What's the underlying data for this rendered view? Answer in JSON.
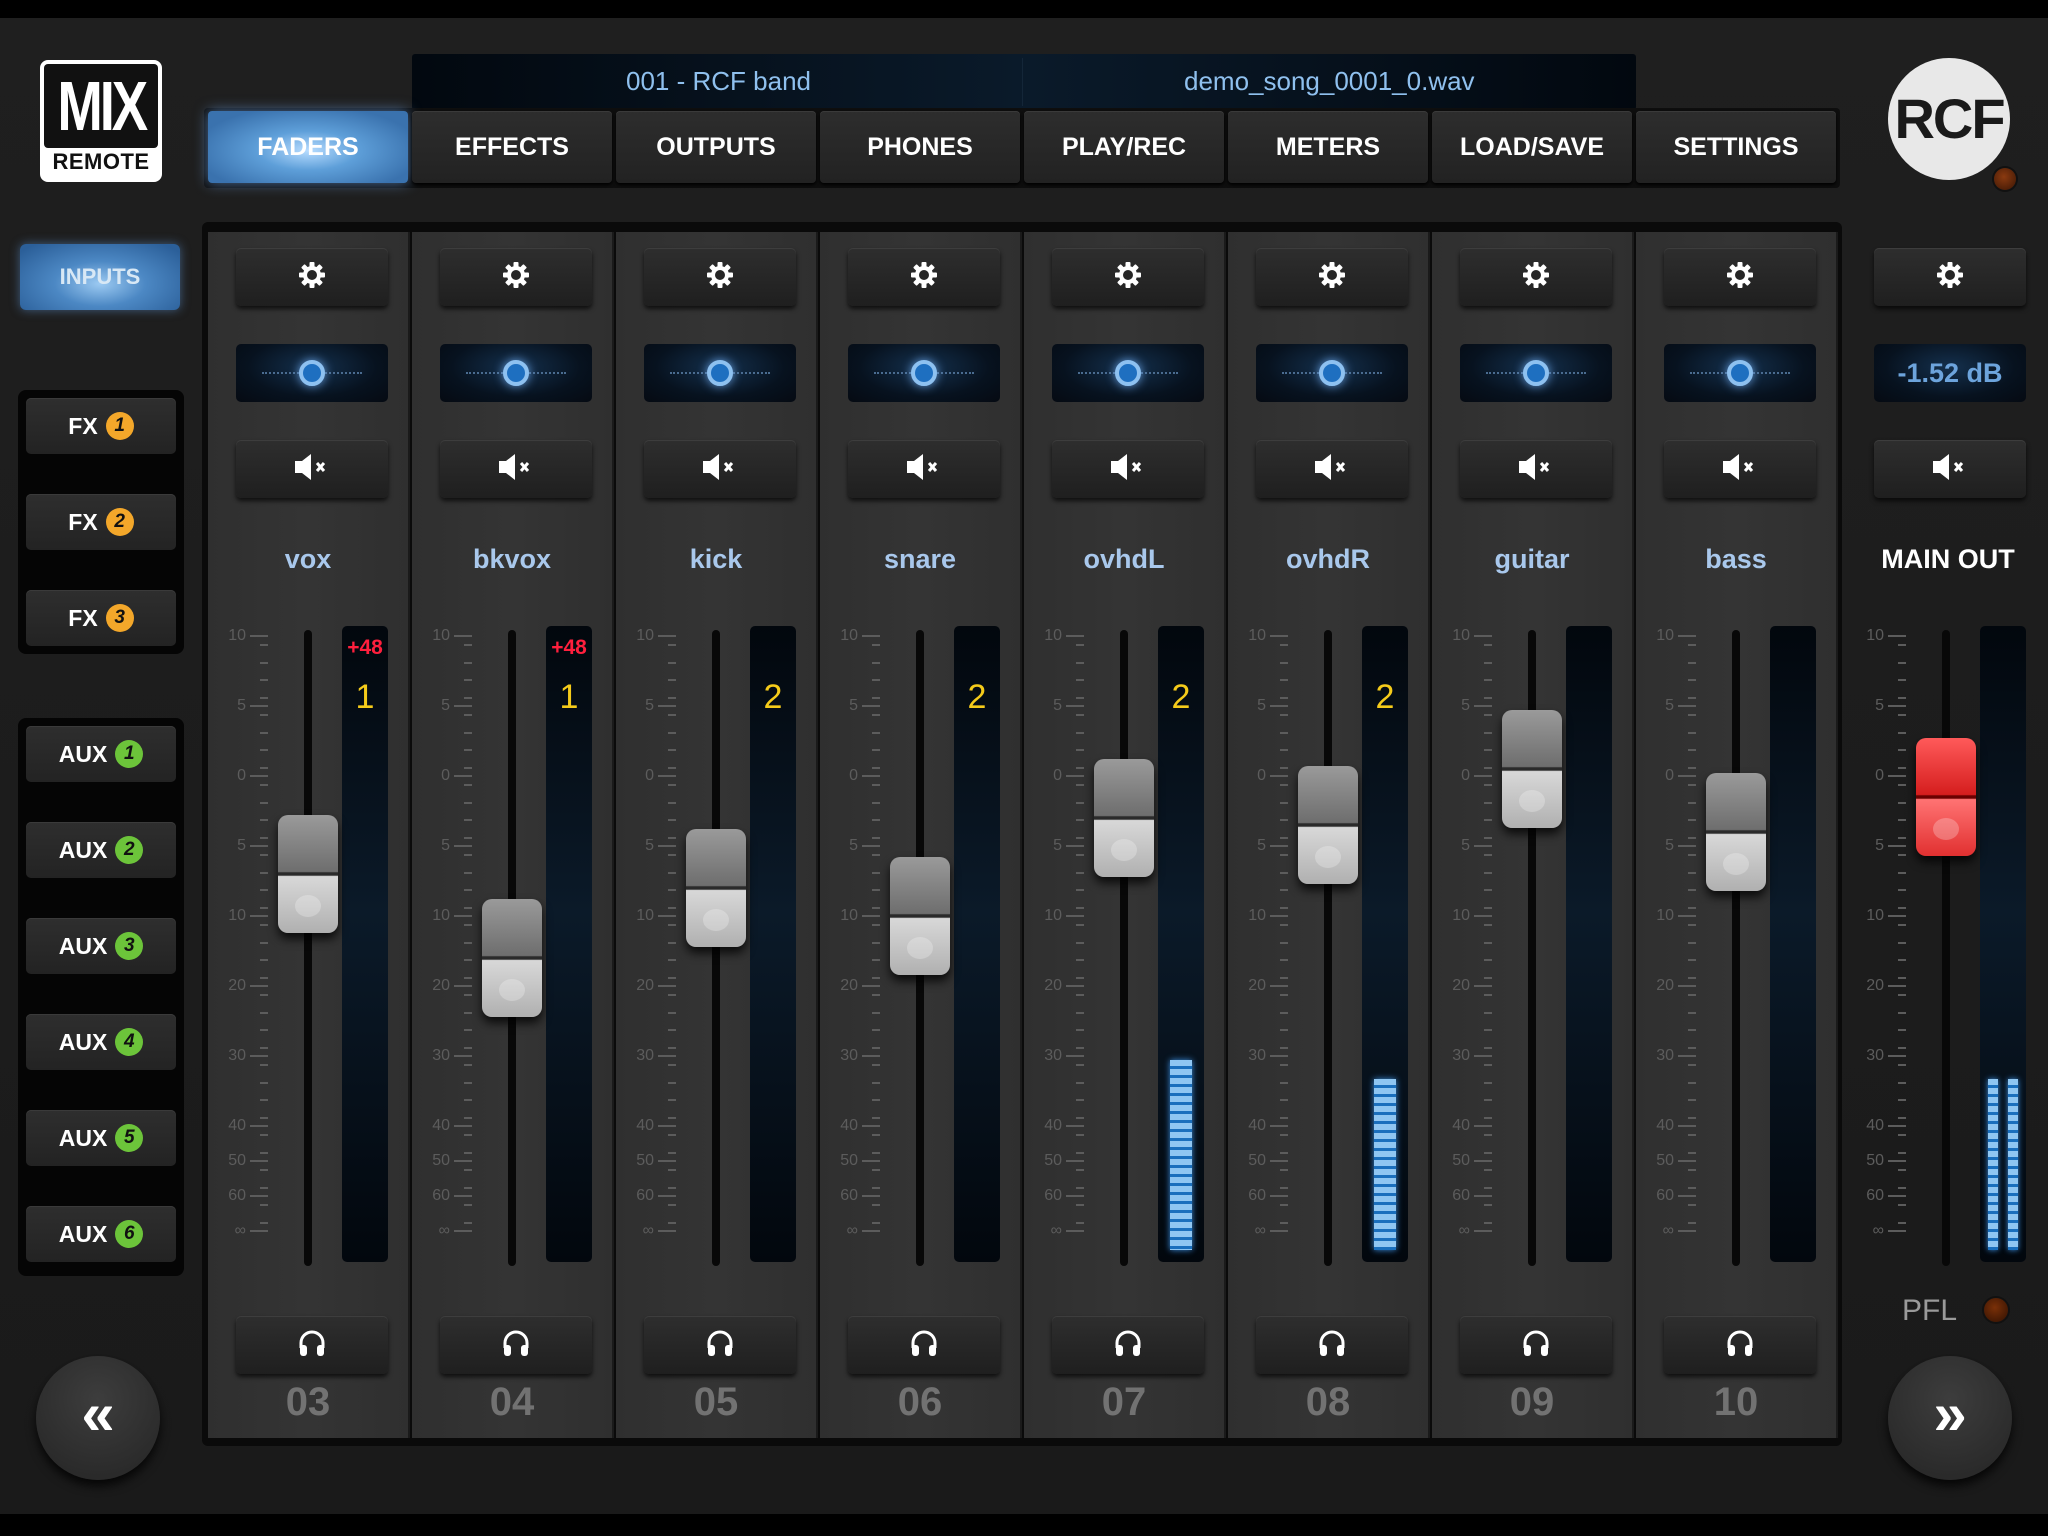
{
  "app": {
    "logo_top": "MIX",
    "logo_bottom": "REMOTE",
    "brand_logo": "RCF"
  },
  "song_bar": {
    "scene": "001 - RCF band",
    "file": "demo_song_0001_0.wav"
  },
  "tabs": [
    {
      "label": "FADERS",
      "active": true
    },
    {
      "label": "EFFECTS",
      "active": false
    },
    {
      "label": "OUTPUTS",
      "active": false
    },
    {
      "label": "PHONES",
      "active": false
    },
    {
      "label": "PLAY/REC",
      "active": false
    },
    {
      "label": "METERS",
      "active": false
    },
    {
      "label": "LOAD/SAVE",
      "active": false
    },
    {
      "label": "SETTINGS",
      "active": false
    }
  ],
  "sidebar": {
    "inputs_label": "INPUTS",
    "fx": [
      {
        "label": "FX",
        "num": "1"
      },
      {
        "label": "FX",
        "num": "2"
      },
      {
        "label": "FX",
        "num": "3"
      }
    ],
    "aux": [
      {
        "label": "AUX",
        "num": "1"
      },
      {
        "label": "AUX",
        "num": "2"
      },
      {
        "label": "AUX",
        "num": "3"
      },
      {
        "label": "AUX",
        "num": "4"
      },
      {
        "label": "AUX",
        "num": "5"
      },
      {
        "label": "AUX",
        "num": "6"
      }
    ],
    "fx_badge_color": "#f3a72a",
    "aux_badge_color": "#6cc43a"
  },
  "scale_labels": [
    "10",
    "5",
    "0",
    "5",
    "10",
    "20",
    "30",
    "40",
    "50",
    "60",
    "∞"
  ],
  "channels": [
    {
      "name": "vox",
      "number": "03",
      "phantom": "+48",
      "group": "1",
      "fader_db": -7,
      "pan": 0,
      "meter_level": 0
    },
    {
      "name": "bkvox",
      "number": "04",
      "phantom": "+48",
      "group": "1",
      "fader_db": -16,
      "pan": 0,
      "meter_level": 0
    },
    {
      "name": "kick",
      "number": "05",
      "phantom": "",
      "group": "2",
      "fader_db": -8,
      "pan": 0,
      "meter_level": 0
    },
    {
      "name": "snare",
      "number": "06",
      "phantom": "",
      "group": "2",
      "fader_db": -10,
      "pan": 0,
      "meter_level": 0
    },
    {
      "name": "ovhdL",
      "number": "07",
      "phantom": "",
      "group": "2",
      "fader_db": -3,
      "pan": 0,
      "meter_level": 0.31
    },
    {
      "name": "ovhdR",
      "number": "08",
      "phantom": "",
      "group": "2",
      "fader_db": -3.5,
      "pan": 0,
      "meter_level": 0.28
    },
    {
      "name": "guitar",
      "number": "09",
      "phantom": "",
      "group": "",
      "fader_db": 0.5,
      "pan": 0,
      "meter_level": 0
    },
    {
      "name": "bass",
      "number": "10",
      "phantom": "",
      "group": "",
      "fader_db": -4,
      "pan": 0,
      "meter_level": 0
    }
  ],
  "main_out": {
    "label": "MAIN OUT",
    "db_readout": "-1.52 dB",
    "fader_db": -1.52,
    "meter_level_l": 0.28,
    "meter_level_r": 0.28,
    "pfl_label": "PFL"
  },
  "nav": {
    "prev": "«",
    "next": "»"
  }
}
